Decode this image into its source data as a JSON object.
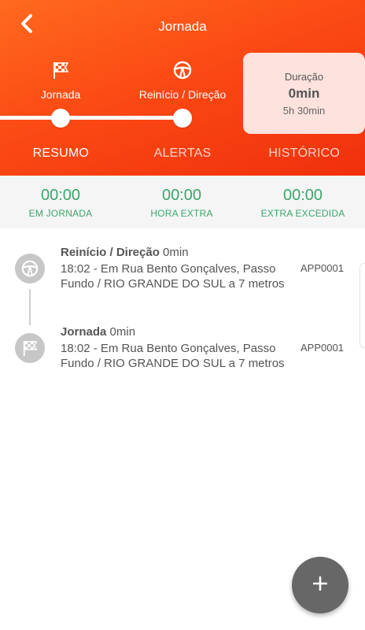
{
  "header": {
    "title": "Jornada",
    "back_icon": "chevron-left-icon"
  },
  "progress": {
    "steps": [
      {
        "label": "Jornada",
        "icon": "checkered-flag-icon"
      },
      {
        "label": "Reinício / Direção",
        "icon": "steering-wheel-icon"
      }
    ]
  },
  "duration": {
    "label": "Duração",
    "value": "0min",
    "sub": "5h 30min"
  },
  "tabs": [
    {
      "label": "RESUMO",
      "active": true
    },
    {
      "label": "ALERTAS",
      "active": false
    },
    {
      "label": "HISTÓRICO",
      "active": false
    }
  ],
  "summary": [
    {
      "time": "00:00",
      "caption": "EM JORNADA"
    },
    {
      "time": "00:00",
      "caption": "HORA EXTRA"
    },
    {
      "time": "00:00",
      "caption": "EXTRA EXCEDIDA"
    }
  ],
  "timeline": [
    {
      "icon": "steering-wheel-icon",
      "title": "Reinício / Direção",
      "duration": "0min",
      "address": "18:02 - Em Rua Bento Gonçalves, Passo Fundo / RIO GRANDE DO SUL a 7 metros",
      "code": "APP0001"
    },
    {
      "icon": "checkered-flag-icon",
      "title": "Jornada",
      "duration": "0min",
      "address": "18:02 - Em Rua Bento Gonçalves, Passo Fundo / RIO GRANDE DO SUL a 7 metros",
      "code": "APP0001"
    }
  ],
  "fab": {
    "icon": "plus-icon"
  },
  "colors": {
    "accent": "#fb4a14",
    "summary_green": "#3aa66a",
    "card_bg": "#fde2dd",
    "fab": "#676767"
  }
}
